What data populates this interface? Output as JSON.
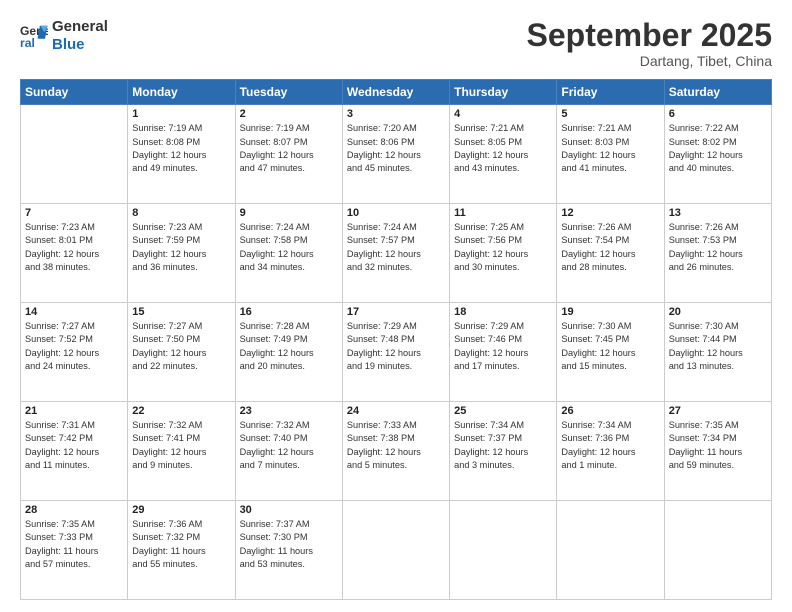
{
  "logo": {
    "line1": "General",
    "line2": "Blue"
  },
  "header": {
    "month": "September 2025",
    "location": "Dartang, Tibet, China"
  },
  "weekdays": [
    "Sunday",
    "Monday",
    "Tuesday",
    "Wednesday",
    "Thursday",
    "Friday",
    "Saturday"
  ],
  "weeks": [
    [
      {
        "day": "",
        "info": ""
      },
      {
        "day": "1",
        "info": "Sunrise: 7:19 AM\nSunset: 8:08 PM\nDaylight: 12 hours\nand 49 minutes."
      },
      {
        "day": "2",
        "info": "Sunrise: 7:19 AM\nSunset: 8:07 PM\nDaylight: 12 hours\nand 47 minutes."
      },
      {
        "day": "3",
        "info": "Sunrise: 7:20 AM\nSunset: 8:06 PM\nDaylight: 12 hours\nand 45 minutes."
      },
      {
        "day": "4",
        "info": "Sunrise: 7:21 AM\nSunset: 8:05 PM\nDaylight: 12 hours\nand 43 minutes."
      },
      {
        "day": "5",
        "info": "Sunrise: 7:21 AM\nSunset: 8:03 PM\nDaylight: 12 hours\nand 41 minutes."
      },
      {
        "day": "6",
        "info": "Sunrise: 7:22 AM\nSunset: 8:02 PM\nDaylight: 12 hours\nand 40 minutes."
      }
    ],
    [
      {
        "day": "7",
        "info": "Sunrise: 7:23 AM\nSunset: 8:01 PM\nDaylight: 12 hours\nand 38 minutes."
      },
      {
        "day": "8",
        "info": "Sunrise: 7:23 AM\nSunset: 7:59 PM\nDaylight: 12 hours\nand 36 minutes."
      },
      {
        "day": "9",
        "info": "Sunrise: 7:24 AM\nSunset: 7:58 PM\nDaylight: 12 hours\nand 34 minutes."
      },
      {
        "day": "10",
        "info": "Sunrise: 7:24 AM\nSunset: 7:57 PM\nDaylight: 12 hours\nand 32 minutes."
      },
      {
        "day": "11",
        "info": "Sunrise: 7:25 AM\nSunset: 7:56 PM\nDaylight: 12 hours\nand 30 minutes."
      },
      {
        "day": "12",
        "info": "Sunrise: 7:26 AM\nSunset: 7:54 PM\nDaylight: 12 hours\nand 28 minutes."
      },
      {
        "day": "13",
        "info": "Sunrise: 7:26 AM\nSunset: 7:53 PM\nDaylight: 12 hours\nand 26 minutes."
      }
    ],
    [
      {
        "day": "14",
        "info": "Sunrise: 7:27 AM\nSunset: 7:52 PM\nDaylight: 12 hours\nand 24 minutes."
      },
      {
        "day": "15",
        "info": "Sunrise: 7:27 AM\nSunset: 7:50 PM\nDaylight: 12 hours\nand 22 minutes."
      },
      {
        "day": "16",
        "info": "Sunrise: 7:28 AM\nSunset: 7:49 PM\nDaylight: 12 hours\nand 20 minutes."
      },
      {
        "day": "17",
        "info": "Sunrise: 7:29 AM\nSunset: 7:48 PM\nDaylight: 12 hours\nand 19 minutes."
      },
      {
        "day": "18",
        "info": "Sunrise: 7:29 AM\nSunset: 7:46 PM\nDaylight: 12 hours\nand 17 minutes."
      },
      {
        "day": "19",
        "info": "Sunrise: 7:30 AM\nSunset: 7:45 PM\nDaylight: 12 hours\nand 15 minutes."
      },
      {
        "day": "20",
        "info": "Sunrise: 7:30 AM\nSunset: 7:44 PM\nDaylight: 12 hours\nand 13 minutes."
      }
    ],
    [
      {
        "day": "21",
        "info": "Sunrise: 7:31 AM\nSunset: 7:42 PM\nDaylight: 12 hours\nand 11 minutes."
      },
      {
        "day": "22",
        "info": "Sunrise: 7:32 AM\nSunset: 7:41 PM\nDaylight: 12 hours\nand 9 minutes."
      },
      {
        "day": "23",
        "info": "Sunrise: 7:32 AM\nSunset: 7:40 PM\nDaylight: 12 hours\nand 7 minutes."
      },
      {
        "day": "24",
        "info": "Sunrise: 7:33 AM\nSunset: 7:38 PM\nDaylight: 12 hours\nand 5 minutes."
      },
      {
        "day": "25",
        "info": "Sunrise: 7:34 AM\nSunset: 7:37 PM\nDaylight: 12 hours\nand 3 minutes."
      },
      {
        "day": "26",
        "info": "Sunrise: 7:34 AM\nSunset: 7:36 PM\nDaylight: 12 hours\nand 1 minute."
      },
      {
        "day": "27",
        "info": "Sunrise: 7:35 AM\nSunset: 7:34 PM\nDaylight: 11 hours\nand 59 minutes."
      }
    ],
    [
      {
        "day": "28",
        "info": "Sunrise: 7:35 AM\nSunset: 7:33 PM\nDaylight: 11 hours\nand 57 minutes."
      },
      {
        "day": "29",
        "info": "Sunrise: 7:36 AM\nSunset: 7:32 PM\nDaylight: 11 hours\nand 55 minutes."
      },
      {
        "day": "30",
        "info": "Sunrise: 7:37 AM\nSunset: 7:30 PM\nDaylight: 11 hours\nand 53 minutes."
      },
      {
        "day": "",
        "info": ""
      },
      {
        "day": "",
        "info": ""
      },
      {
        "day": "",
        "info": ""
      },
      {
        "day": "",
        "info": ""
      }
    ]
  ]
}
